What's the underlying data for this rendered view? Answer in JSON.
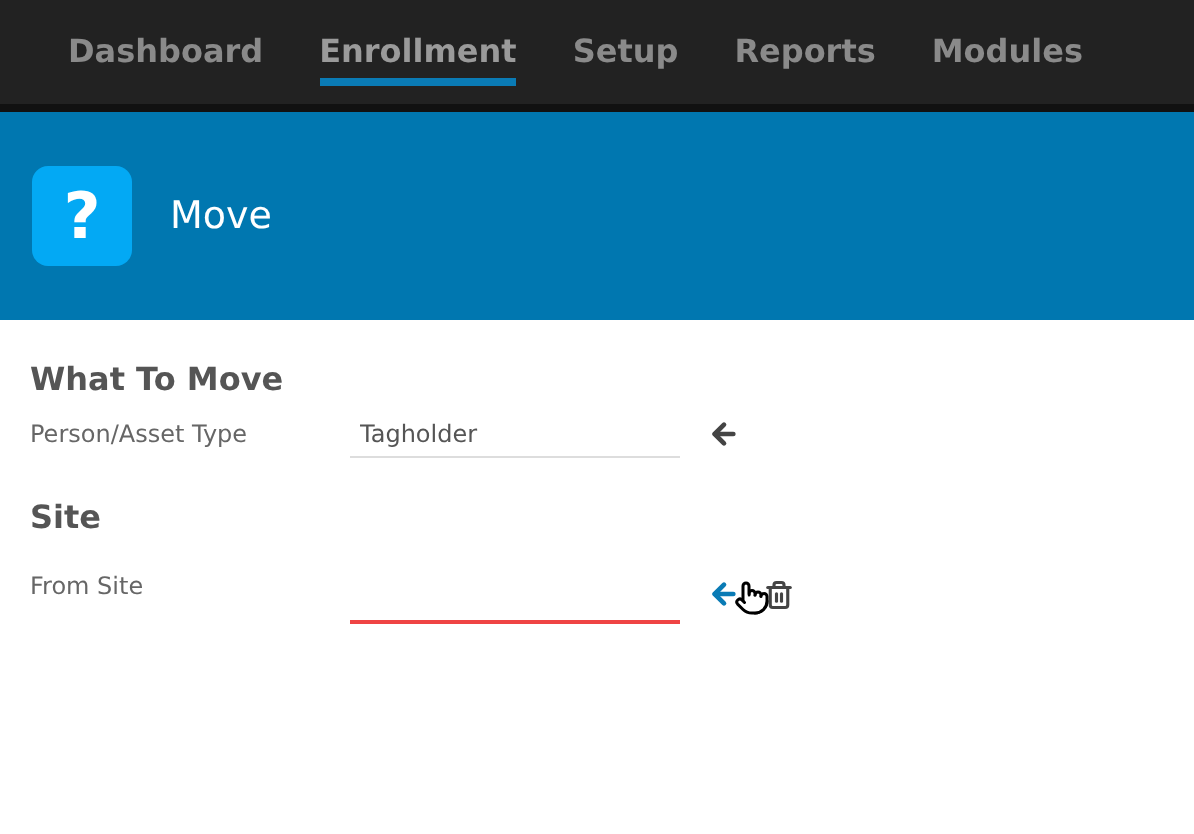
{
  "nav": [
    {
      "label": "Dashboard",
      "selected": false
    },
    {
      "label": "Enrollment",
      "selected": true
    },
    {
      "label": "Setup",
      "selected": false
    },
    {
      "label": "Reports",
      "selected": false
    },
    {
      "label": "Modules",
      "selected": false
    }
  ],
  "header": {
    "icon": "?",
    "title": "Move"
  },
  "sections": [
    {
      "title": "What To Move",
      "fields": [
        {
          "label": "Person/Asset Type",
          "value": "Tagholder",
          "invalid": false,
          "hovered": false,
          "deletable": false
        }
      ]
    },
    {
      "title": "Site",
      "fields": [
        {
          "label": "From Site",
          "invalid": true,
          "hovered": true,
          "deletable": true
        }
      ]
    }
  ]
}
